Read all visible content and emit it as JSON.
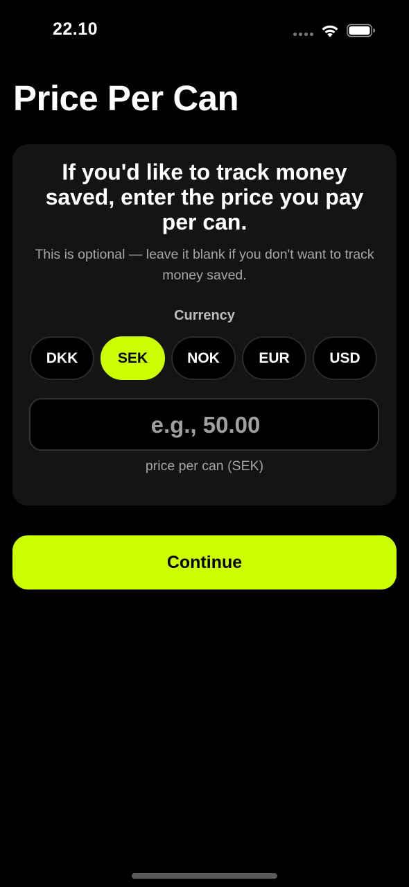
{
  "status_bar": {
    "time": "22.10"
  },
  "title": "Price Per Can",
  "card": {
    "heading": "If you'd like to track money saved, enter the price you pay per can.",
    "subtitle": "This is optional — leave it blank if you don't want to track money saved.",
    "currency_label": "Currency",
    "currencies": [
      "DKK",
      "SEK",
      "NOK",
      "EUR",
      "USD"
    ],
    "selected_currency": "SEK",
    "price_input": {
      "value": "",
      "placeholder": "e.g., 50.00"
    },
    "price_caption": "price per can (SEK)"
  },
  "continue_label": "Continue",
  "colors": {
    "accent": "#ccff00",
    "background": "#000000",
    "card": "#141414"
  }
}
